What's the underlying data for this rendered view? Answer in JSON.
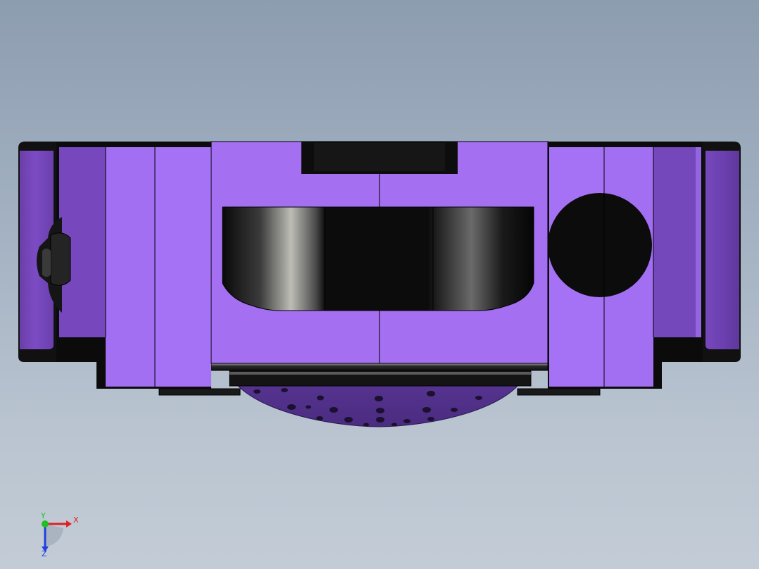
{
  "viewport": {
    "background_top": "#8d9db0",
    "background_bottom": "#c3ccd6"
  },
  "model": {
    "body_color": "#a46ff0",
    "body_shade_color": "#8a5ad6",
    "edge_color": "#000000"
  },
  "triad": {
    "x_label": "X",
    "y_label": "Y",
    "z_label": "Z",
    "x_color": "#e02020",
    "y_color": "#20c020",
    "z_color": "#2040e0"
  }
}
